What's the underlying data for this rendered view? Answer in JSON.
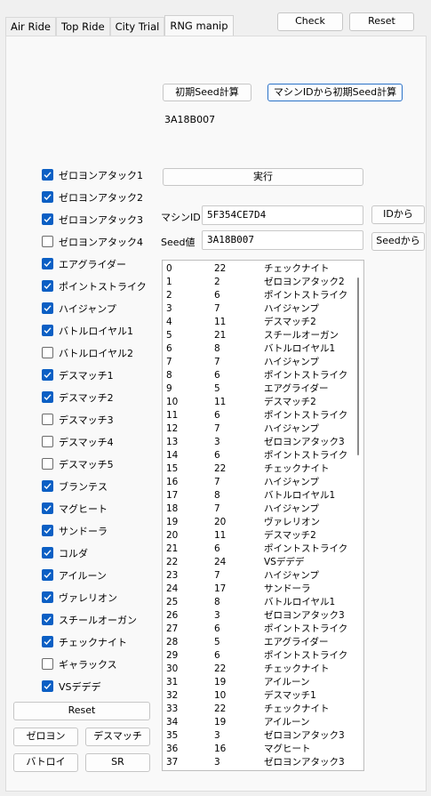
{
  "tabs": [
    "Air Ride",
    "Top Ride",
    "City Trial",
    "RNG manip"
  ],
  "header_buttons": {
    "check": "Check",
    "reset": "Reset"
  },
  "seed_calc": {
    "initial_seed_button": "初期Seed計算",
    "from_machine_button": "マシンIDから初期Seed計算",
    "result": "3A18B007"
  },
  "run_button": "実行",
  "machine_id": {
    "label": "マシンID",
    "value": "5F354CE7D4",
    "button": "IDから"
  },
  "seed": {
    "label": "Seed値",
    "value": "3A18B007",
    "button": "Seedから"
  },
  "checkboxes": [
    {
      "label": "ゼロヨンアタック1",
      "checked": true
    },
    {
      "label": "ゼロヨンアタック2",
      "checked": true
    },
    {
      "label": "ゼロヨンアタック3",
      "checked": true
    },
    {
      "label": "ゼロヨンアタック4",
      "checked": false
    },
    {
      "label": "エアグライダー",
      "checked": true
    },
    {
      "label": "ポイントストライク",
      "checked": true
    },
    {
      "label": "ハイジャンプ",
      "checked": true
    },
    {
      "label": "バトルロイヤル1",
      "checked": true
    },
    {
      "label": "バトルロイヤル2",
      "checked": false
    },
    {
      "label": "デスマッチ1",
      "checked": true
    },
    {
      "label": "デスマッチ2",
      "checked": true
    },
    {
      "label": "デスマッチ3",
      "checked": false
    },
    {
      "label": "デスマッチ4",
      "checked": false
    },
    {
      "label": "デスマッチ5",
      "checked": false
    },
    {
      "label": "ブランテス",
      "checked": true
    },
    {
      "label": "マグヒート",
      "checked": true
    },
    {
      "label": "サンドーラ",
      "checked": true
    },
    {
      "label": "コルダ",
      "checked": true
    },
    {
      "label": "アイルーン",
      "checked": true
    },
    {
      "label": "ヴァレリオン",
      "checked": true
    },
    {
      "label": "スチールオーガン",
      "checked": true
    },
    {
      "label": "チェックナイト",
      "checked": true
    },
    {
      "label": "ギャラックス",
      "checked": false
    },
    {
      "label": "VSデデデ",
      "checked": true
    }
  ],
  "bottom_buttons": {
    "reset": "Reset",
    "zeroyon": "ゼロヨン",
    "deathmatch": "デスマッチ",
    "battleroyal": "バトロイ",
    "sr": "SR"
  },
  "results": [
    [
      "0",
      "22",
      "チェックナイト"
    ],
    [
      "1",
      "2",
      "ゼロヨンアタック2"
    ],
    [
      "2",
      "6",
      "ポイントストライク"
    ],
    [
      "3",
      "7",
      "ハイジャンプ"
    ],
    [
      "4",
      "11",
      "デスマッチ2"
    ],
    [
      "5",
      "21",
      "スチールオーガン"
    ],
    [
      "6",
      "8",
      "バトルロイヤル1"
    ],
    [
      "7",
      "7",
      "ハイジャンプ"
    ],
    [
      "8",
      "6",
      "ポイントストライク"
    ],
    [
      "9",
      "5",
      "エアグライダー"
    ],
    [
      "10",
      "11",
      "デスマッチ2"
    ],
    [
      "11",
      "6",
      "ポイントストライク"
    ],
    [
      "12",
      "7",
      "ハイジャンプ"
    ],
    [
      "13",
      "3",
      "ゼロヨンアタック3"
    ],
    [
      "14",
      "6",
      "ポイントストライク"
    ],
    [
      "15",
      "22",
      "チェックナイト"
    ],
    [
      "16",
      "7",
      "ハイジャンプ"
    ],
    [
      "17",
      "8",
      "バトルロイヤル1"
    ],
    [
      "18",
      "7",
      "ハイジャンプ"
    ],
    [
      "19",
      "20",
      "ヴァレリオン"
    ],
    [
      "20",
      "11",
      "デスマッチ2"
    ],
    [
      "21",
      "6",
      "ポイントストライク"
    ],
    [
      "22",
      "24",
      "VSデデデ"
    ],
    [
      "23",
      "7",
      "ハイジャンプ"
    ],
    [
      "24",
      "17",
      "サンドーラ"
    ],
    [
      "25",
      "8",
      "バトルロイヤル1"
    ],
    [
      "26",
      "3",
      "ゼロヨンアタック3"
    ],
    [
      "27",
      "6",
      "ポイントストライク"
    ],
    [
      "28",
      "5",
      "エアグライダー"
    ],
    [
      "29",
      "6",
      "ポイントストライク"
    ],
    [
      "30",
      "22",
      "チェックナイト"
    ],
    [
      "31",
      "19",
      "アイルーン"
    ],
    [
      "32",
      "10",
      "デスマッチ1"
    ],
    [
      "33",
      "22",
      "チェックナイト"
    ],
    [
      "34",
      "19",
      "アイルーン"
    ],
    [
      "35",
      "3",
      "ゼロヨンアタック3"
    ],
    [
      "36",
      "16",
      "マグヒート"
    ],
    [
      "37",
      "3",
      "ゼロヨンアタック3"
    ]
  ]
}
